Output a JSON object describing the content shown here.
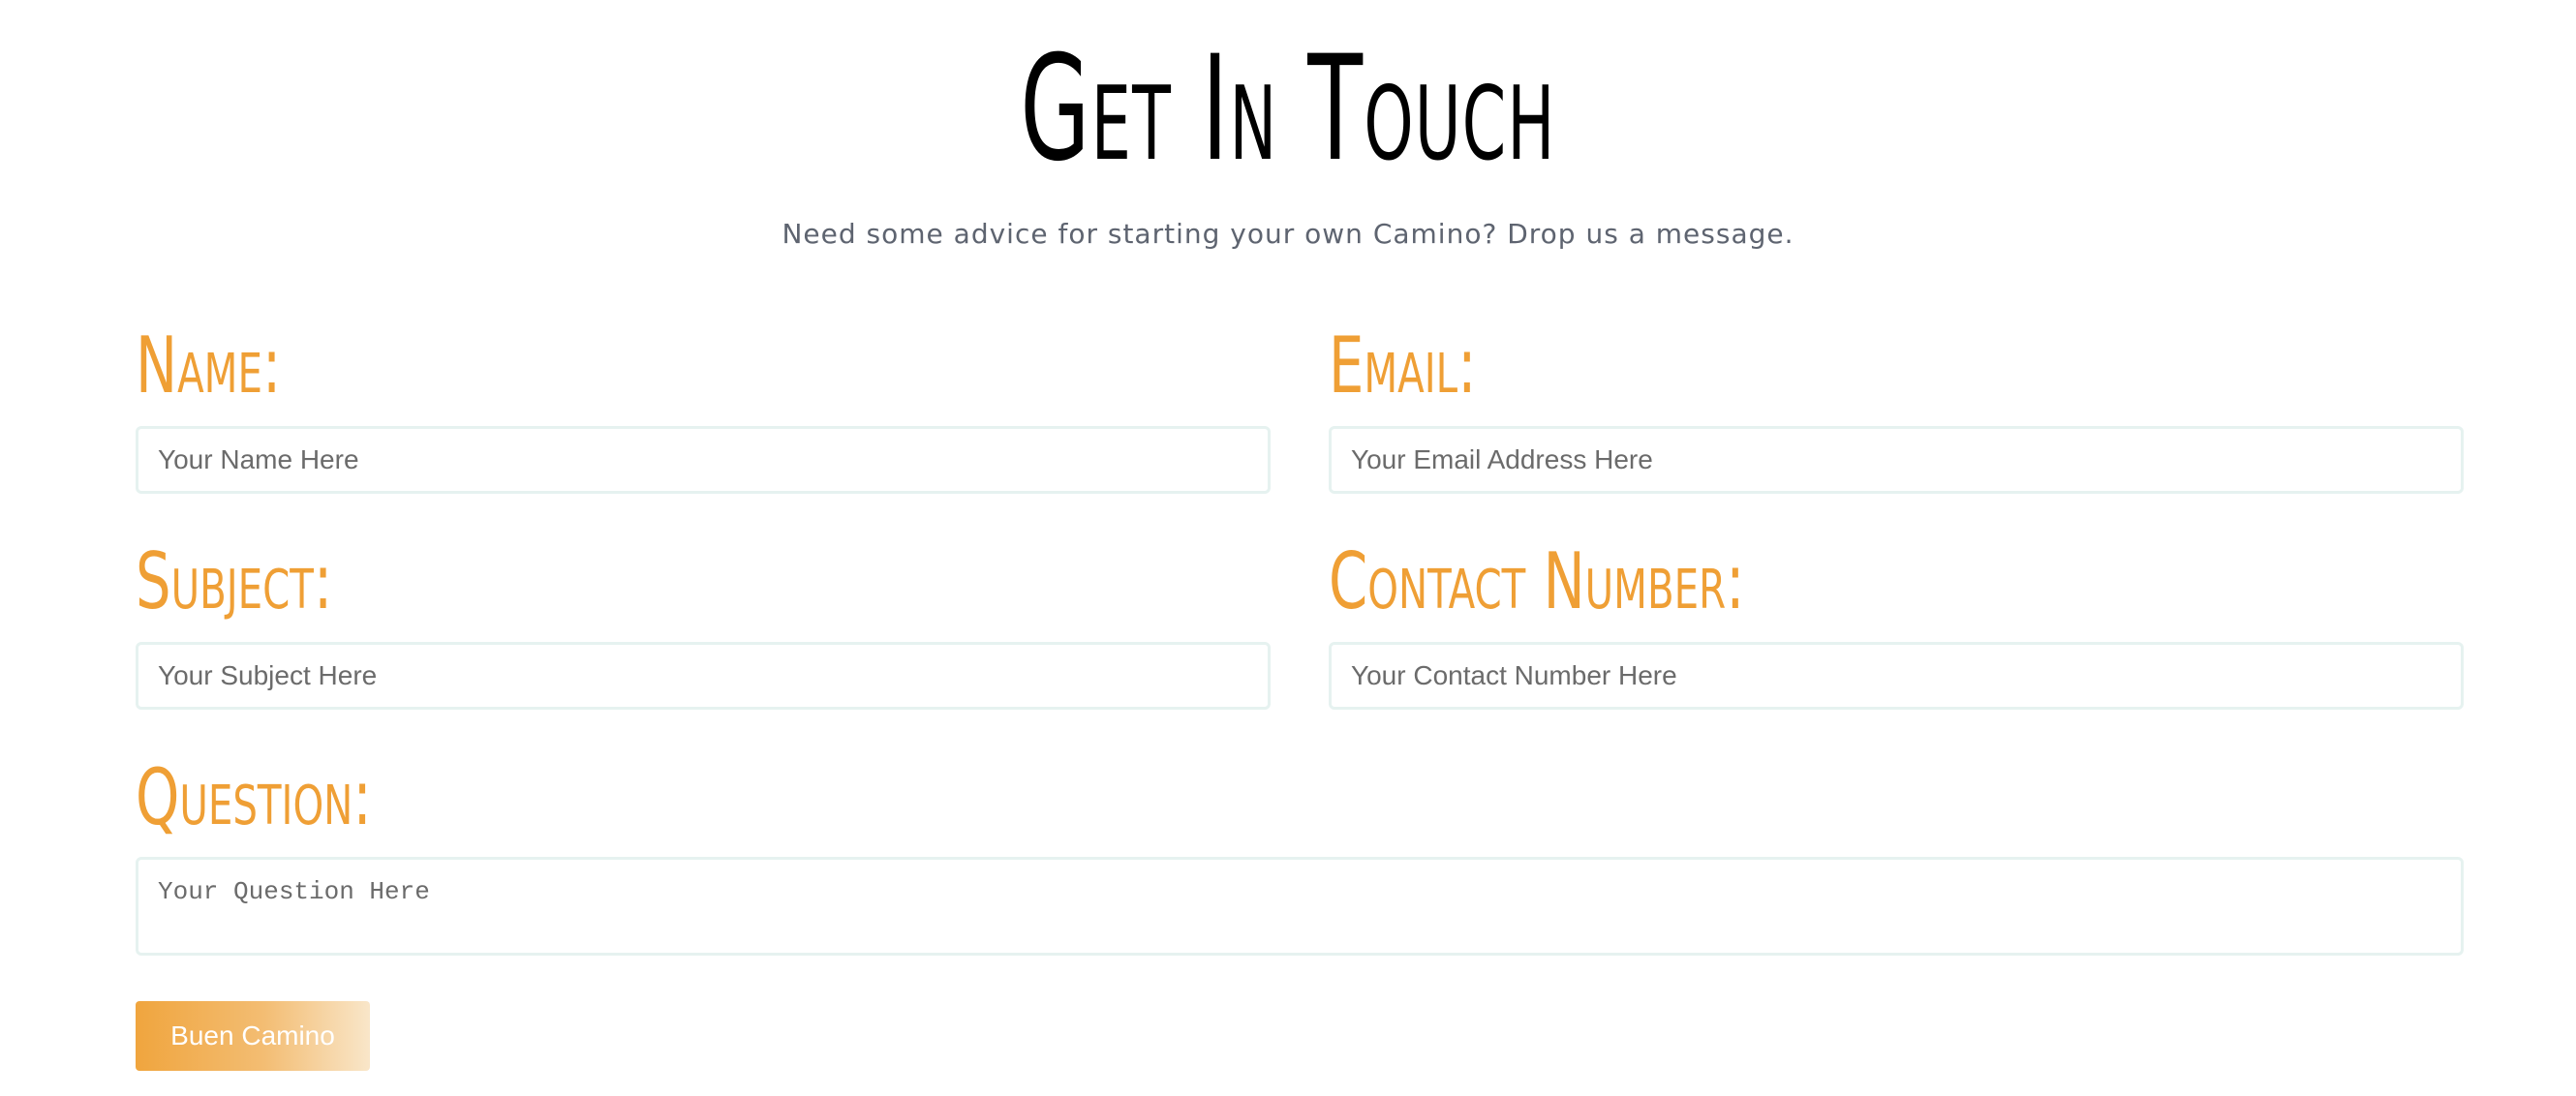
{
  "header": {
    "title": "Get In Touch",
    "subtitle": "Need some advice for starting your own Camino? Drop us a message."
  },
  "form": {
    "name": {
      "label": "Name:",
      "placeholder": "Your Name Here"
    },
    "email": {
      "label": "Email:",
      "placeholder": "Your Email Address Here"
    },
    "subject": {
      "label": "Subject:",
      "placeholder": "Your Subject Here"
    },
    "contact_number": {
      "label": "Contact Number:",
      "placeholder": "Your Contact Number Here"
    },
    "question": {
      "label": "Question:",
      "placeholder": "Your Question Here"
    },
    "submit_label": "Buen Camino"
  },
  "colors": {
    "label": "#ef9f35",
    "heading": "#000000",
    "subtitle": "#5e6470",
    "input_border": "#e6f2f0",
    "button_start": "#f0a53e",
    "button_end": "#f9e6c9"
  }
}
